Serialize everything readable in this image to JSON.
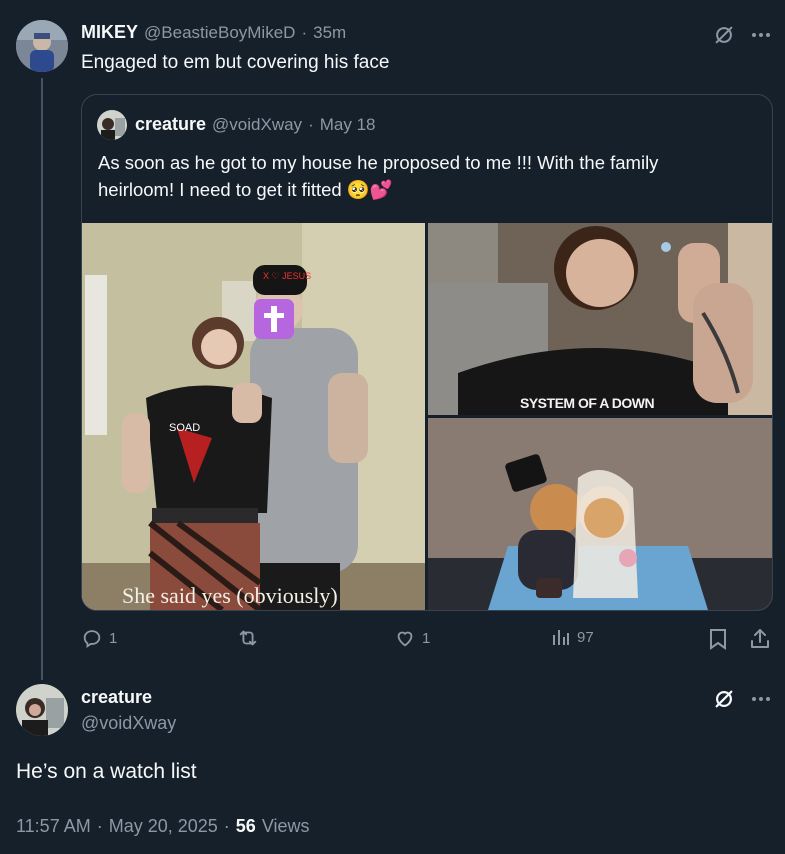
{
  "parent_tweet": {
    "display_name": "MIKEY",
    "handle": "@BeastieBoyMikeD",
    "separator": "·",
    "time": "35m",
    "text": "Engaged to em but covering his face",
    "icons": [
      "grok-icon",
      "more-icon"
    ]
  },
  "quoted_tweet": {
    "display_name": "creature",
    "handle": "@voidXway",
    "separator": "·",
    "date": "May 18",
    "text_line1": "As soon as he got to my house he proposed to me !!! With the family",
    "text_line2": "heirloom! I need to get it fitted 🥺💕",
    "photo_caption": "She said yes (obviously)",
    "photo_shirt_text": "SYSTEM OF A DOWN",
    "photo_cap_text": "X ♡ JESUS"
  },
  "parent_actions": {
    "replies": "1",
    "retweets": "",
    "likes": "1",
    "views": "97"
  },
  "main_tweet": {
    "display_name": "creature",
    "handle": "@voidXway",
    "text": "He’s on a watch list",
    "time": "11:57 AM",
    "sep1": "·",
    "date": "May 20, 2025",
    "sep2": "·",
    "views_count": "56",
    "views_label": "Views",
    "icons": [
      "grok-icon",
      "more-icon"
    ]
  },
  "colors": {
    "background": "#15202b",
    "text_primary": "#f7f9f9",
    "text_secondary": "#8b98a5",
    "border": "#38444d",
    "thread_line": "#425364"
  }
}
